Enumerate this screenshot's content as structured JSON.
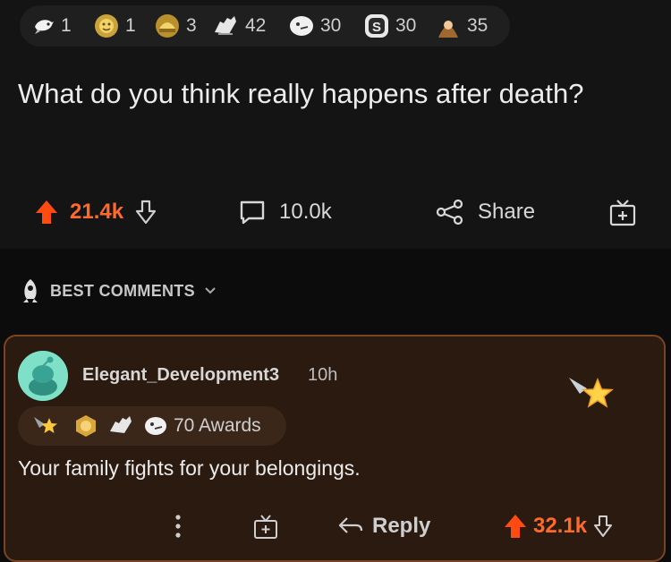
{
  "post": {
    "awards": [
      {
        "icon": "bird-award-icon",
        "count": "1"
      },
      {
        "icon": "sun-award-icon",
        "count": "1"
      },
      {
        "icon": "helmet-award-icon",
        "count": "3"
      },
      {
        "icon": "hands-award-icon",
        "count": "42"
      },
      {
        "icon": "bubble-award-icon",
        "count": "30"
      },
      {
        "icon": "coin-award-icon",
        "count": "30"
      },
      {
        "icon": "monk-award-icon",
        "count": "35"
      }
    ],
    "title": "What do you think really happens after death?",
    "upvotes": "21.4k",
    "comments_count": "10.0k",
    "share_label": "Share"
  },
  "best_comments_label": "BEST COMMENTS",
  "comment": {
    "username": "Elegant_Development3",
    "time": "10h",
    "awards_label": "70 Awards",
    "text": "Your family fights for your belongings.",
    "reply_label": "Reply",
    "upvotes": "32.1k"
  },
  "colors": {
    "accent": "#ff6a2b",
    "comment_bg": "#2a1a10",
    "comment_border": "#7a4420"
  }
}
